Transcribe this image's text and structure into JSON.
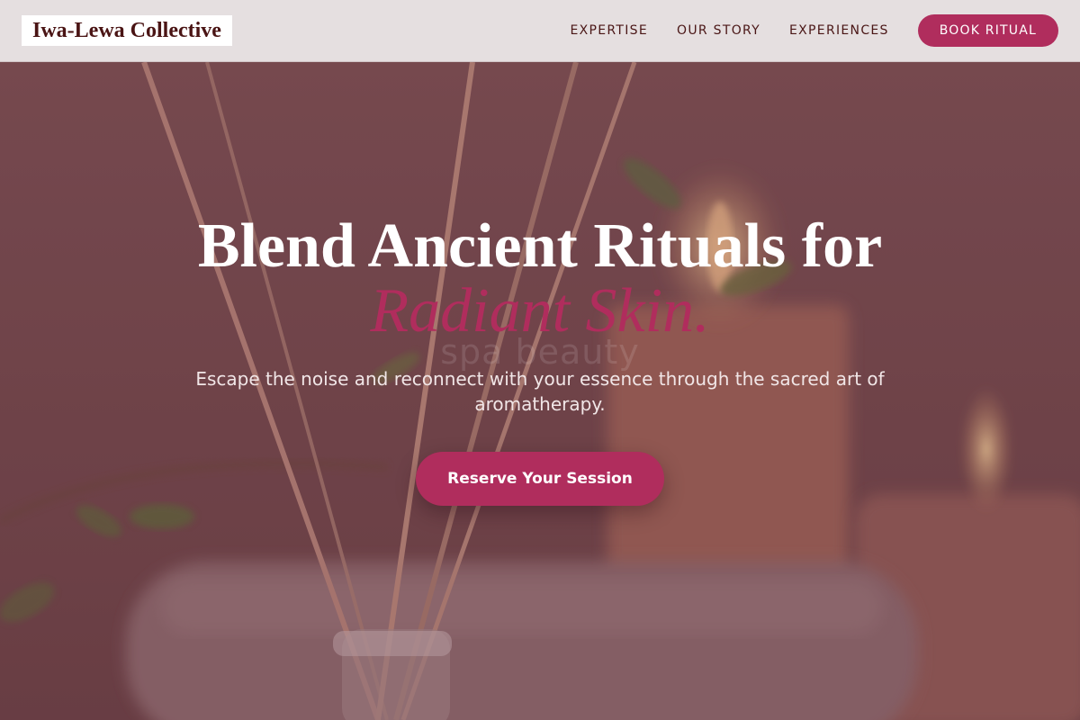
{
  "header": {
    "logo": "Iwa-Lewa Collective",
    "nav": [
      "EXPERTISE",
      "OUR STORY",
      "EXPERIENCES"
    ],
    "cta": "BOOK RITUAL"
  },
  "hero": {
    "headline": "Blend Ancient Rituals for",
    "headline_accent": "Radiant Skin.",
    "ghost_text": "spa beauty",
    "subtitle": "Escape the noise and reconnect with your essence through the sacred art of aromatherapy.",
    "cta": "Reserve Your Session"
  },
  "colors": {
    "accent": "#b02d5d",
    "header_bg": "#e5dfe0",
    "nav_text": "#4a1616",
    "hero_tint": "#6e4a4d"
  }
}
